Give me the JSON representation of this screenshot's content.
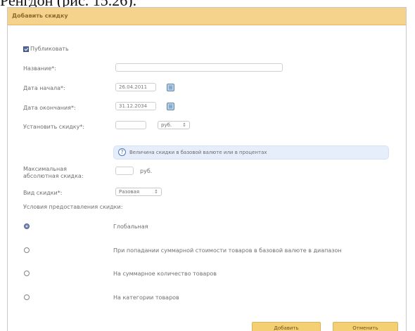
{
  "document": {
    "caption": "Ренгдон (рис. 15.26)."
  },
  "dialog": {
    "title": "Добавить скидку",
    "publish_label": "Публиковать",
    "name_label": "Название*:",
    "start_date_label": "Дата начала*:",
    "start_date_value": "26.04.2011",
    "end_date_label": "Дата окончания*:",
    "end_date_value": "31.12.2034",
    "set_discount_label": "Установить скидку*:",
    "currency_value": "руб.",
    "hint_text": "Величина скидки в базовой валюте или в процентах",
    "max_discount_label_line1": "Максимальная",
    "max_discount_label_line2": "абсолютная скидка:",
    "max_discount_unit": "руб.",
    "discount_type_label": "Вид скидки*:",
    "discount_type_value": "Разовая",
    "conditions_label": "Условия предоставления скидки:",
    "options": [
      {
        "label": "Глобальная",
        "selected": true
      },
      {
        "label": "При попадании суммарной стоимости товаров в базовой валюте в диапазон",
        "selected": false
      },
      {
        "label": "На суммарное количество товаров",
        "selected": false
      },
      {
        "label": "На категории товаров",
        "selected": false
      }
    ],
    "buttons": {
      "save": "Добавить",
      "cancel": "Отменить"
    }
  }
}
